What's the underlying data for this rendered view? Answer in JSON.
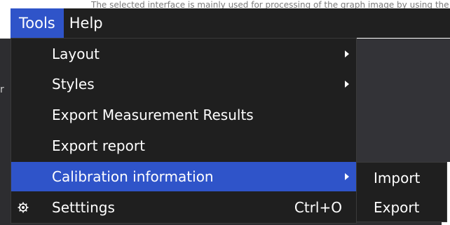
{
  "background": {
    "top_caption": "The selected interface is mainly used for processing of the graph image by using the",
    "left_mark": "r"
  },
  "menubar": {
    "items": [
      {
        "label": "Tools",
        "active": true
      },
      {
        "label": "Help",
        "active": false
      }
    ]
  },
  "tools_menu": {
    "items": [
      {
        "label": "Layout",
        "submenu": true
      },
      {
        "label": "Styles",
        "submenu": true
      },
      {
        "label": "Export Measurement Results"
      },
      {
        "label": "Export report"
      },
      {
        "label": "Calibration information",
        "submenu": true,
        "highlighted": true
      },
      {
        "label": "Setttings",
        "shortcut": "Ctrl+O",
        "icon": "gear-icon"
      }
    ]
  },
  "calibration_submenu": {
    "items": [
      {
        "label": "Import"
      },
      {
        "label": "Export"
      }
    ]
  },
  "colors": {
    "accent": "#2f54c9",
    "menu_bg": "#1f1f1f",
    "menubar_bg": "#202020"
  }
}
